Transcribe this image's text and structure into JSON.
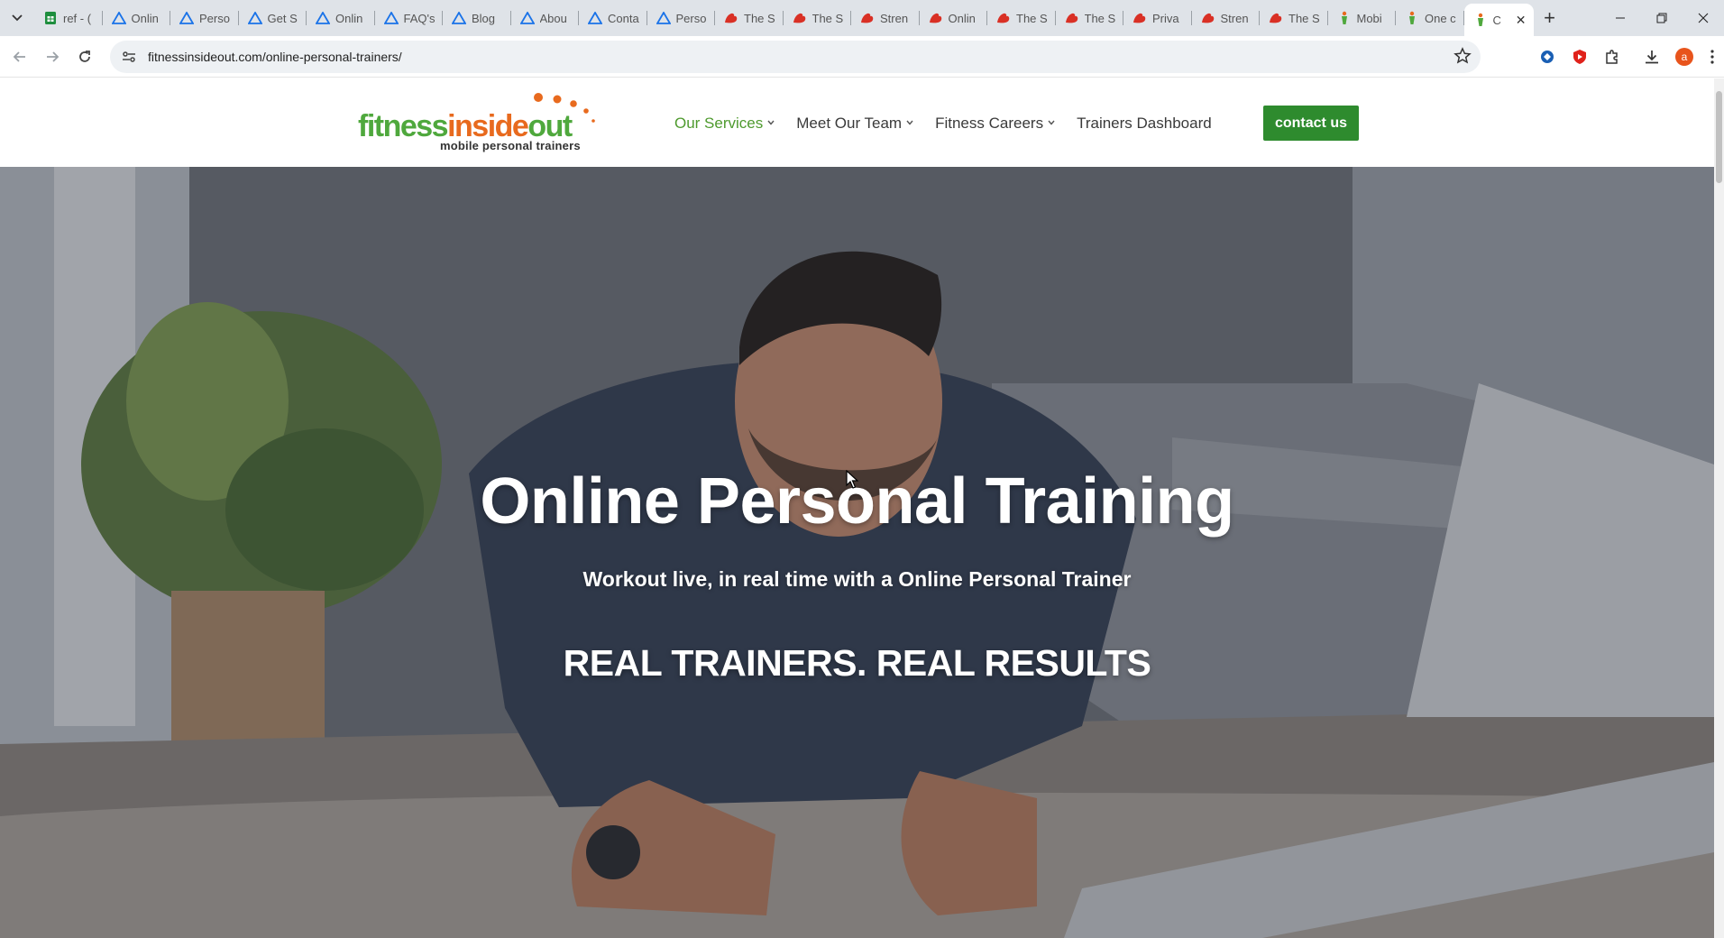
{
  "browser": {
    "tabs": [
      {
        "title": "ref - (",
        "icon": "sheets-icon",
        "color": "#1e8e3e"
      },
      {
        "title": "Onlin",
        "icon": "triangle-icon",
        "color": "#1a73e8"
      },
      {
        "title": "Perso",
        "icon": "triangle-icon",
        "color": "#1a73e8"
      },
      {
        "title": "Get S",
        "icon": "triangle-icon",
        "color": "#1a73e8"
      },
      {
        "title": "Onlin",
        "icon": "triangle-icon",
        "color": "#1a73e8"
      },
      {
        "title": "FAQ's",
        "icon": "triangle-icon",
        "color": "#1a73e8"
      },
      {
        "title": "Blog",
        "icon": "triangle-icon",
        "color": "#1a73e8"
      },
      {
        "title": "Abou",
        "icon": "triangle-icon",
        "color": "#1a73e8"
      },
      {
        "title": "Conta",
        "icon": "triangle-icon",
        "color": "#1a73e8"
      },
      {
        "title": "Perso",
        "icon": "triangle-icon",
        "color": "#1a73e8"
      },
      {
        "title": "The S",
        "icon": "bicep-icon",
        "color": "#d93025"
      },
      {
        "title": "The S",
        "icon": "bicep-icon",
        "color": "#d93025"
      },
      {
        "title": "Stren",
        "icon": "bicep-icon",
        "color": "#d93025"
      },
      {
        "title": "Onlin",
        "icon": "bicep-icon",
        "color": "#d93025"
      },
      {
        "title": "The S",
        "icon": "bicep-icon",
        "color": "#d93025"
      },
      {
        "title": "The S",
        "icon": "bicep-icon",
        "color": "#d93025"
      },
      {
        "title": "Priva",
        "icon": "bicep-icon",
        "color": "#d93025"
      },
      {
        "title": "Stren",
        "icon": "bicep-icon",
        "color": "#d93025"
      },
      {
        "title": "The S",
        "icon": "bicep-icon",
        "color": "#d93025"
      },
      {
        "title": "Mobi",
        "icon": "figure-icon",
        "color": "#e86a1e"
      },
      {
        "title": "One c",
        "icon": "figure-icon",
        "color": "#e86a1e"
      }
    ],
    "active_tab": {
      "title": "C",
      "icon": "figure-icon"
    },
    "new_tab_label": "+",
    "url": "fitnessinsideout.com/online-personal-trainers/",
    "profile_letter": "a"
  },
  "site": {
    "logo": {
      "part1": "fitness",
      "part2": "inside",
      "part3": "out",
      "tagline": "mobile personal trainers"
    },
    "nav": [
      {
        "label": "Our Services",
        "has_dropdown": true,
        "current": true
      },
      {
        "label": "Meet Our Team",
        "has_dropdown": true
      },
      {
        "label": "Fitness Careers",
        "has_dropdown": true
      },
      {
        "label": "Trainers Dashboard",
        "has_dropdown": false
      }
    ],
    "contact_label": "contact us",
    "colors": {
      "brand_green": "#4fa83d",
      "brand_orange": "#e86a1e",
      "button_green": "#2e8b2e"
    }
  },
  "hero": {
    "title": "Online Personal Training",
    "subtitle": "Workout live, in real time with a Online Personal Trainer",
    "tagline": "REAL TRAINERS. REAL RESULTS"
  }
}
